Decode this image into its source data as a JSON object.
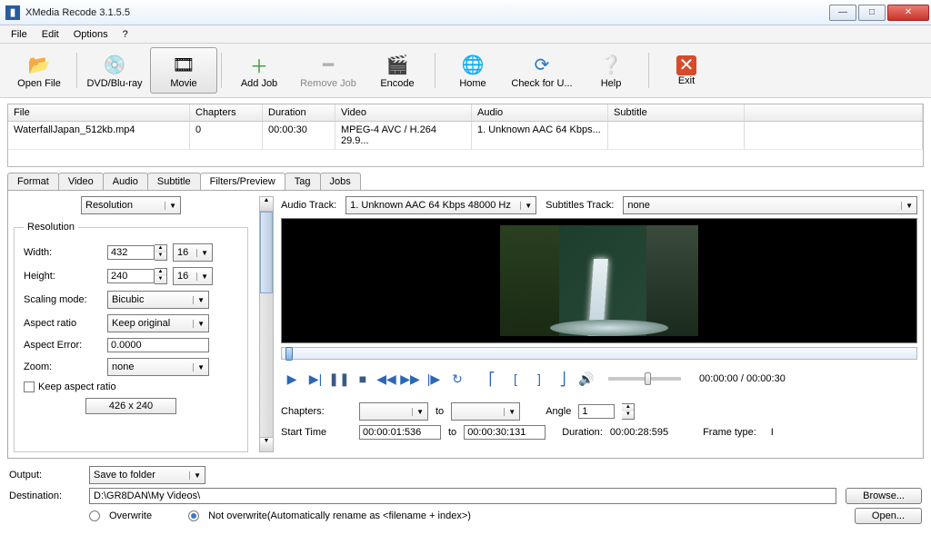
{
  "window": {
    "title": "XMedia Recode 3.1.5.5"
  },
  "menu": {
    "file": "File",
    "edit": "Edit",
    "options": "Options",
    "help": "?"
  },
  "toolbar": {
    "open": "Open File",
    "dvd": "DVD/Blu-ray",
    "movie": "Movie",
    "add": "Add Job",
    "remove": "Remove Job",
    "encode": "Encode",
    "home": "Home",
    "check": "Check for U...",
    "helpbtn": "Help",
    "exit": "Exit"
  },
  "filelist": {
    "headers": {
      "file": "File",
      "chapters": "Chapters",
      "duration": "Duration",
      "video": "Video",
      "audio": "Audio",
      "subtitle": "Subtitle"
    },
    "rows": [
      {
        "file": "WaterfallJapan_512kb.mp4",
        "chapters": "0",
        "duration": "00:00:30",
        "video": "MPEG-4 AVC / H.264 29.9...",
        "audio": "1. Unknown AAC  64 Kbps...",
        "subtitle": ""
      }
    ]
  },
  "tabs": {
    "format": "Format",
    "video": "Video",
    "audio": "Audio",
    "subtitle": "Subtitle",
    "filters": "Filters/Preview",
    "tag": "Tag",
    "jobs": "Jobs"
  },
  "filterpanel": {
    "mode": "Resolution",
    "group": "Resolution",
    "width_lbl": "Width:",
    "width": "432",
    "width_step": "16",
    "height_lbl": "Height:",
    "height": "240",
    "height_step": "16",
    "scaling_lbl": "Scaling mode:",
    "scaling": "Bicubic",
    "aspect_lbl": "Aspect ratio",
    "aspect": "Keep original",
    "error_lbl": "Aspect Error:",
    "error": "0.0000",
    "zoom_lbl": "Zoom:",
    "zoom": "none",
    "keep_ar": "Keep aspect ratio",
    "scale_info": "426 x 240"
  },
  "preview": {
    "audio_lbl": "Audio Track:",
    "audio_sel": "1. Unknown AAC  64 Kbps 48000 Hz",
    "sub_lbl": "Subtitles Track:",
    "sub_sel": "none",
    "time": "00:00:00 / 00:00:30",
    "chapters_lbl": "Chapters:",
    "to": "to",
    "angle_lbl": "Angle",
    "angle": "1",
    "start_lbl": "Start Time",
    "start": "00:00:01:536",
    "end": "00:00:30:131",
    "duration_lbl": "Duration:",
    "duration": "00:00:28:595",
    "frametype_lbl": "Frame type:",
    "frametype": "I"
  },
  "output": {
    "out_lbl": "Output:",
    "out_sel": "Save to folder",
    "dest_lbl": "Destination:",
    "dest": "D:\\GR8DAN\\My Videos\\",
    "browse": "Browse...",
    "open": "Open...",
    "overwrite": "Overwrite",
    "notoverwrite": "Not overwrite(Automatically rename as <filename + index>)"
  }
}
